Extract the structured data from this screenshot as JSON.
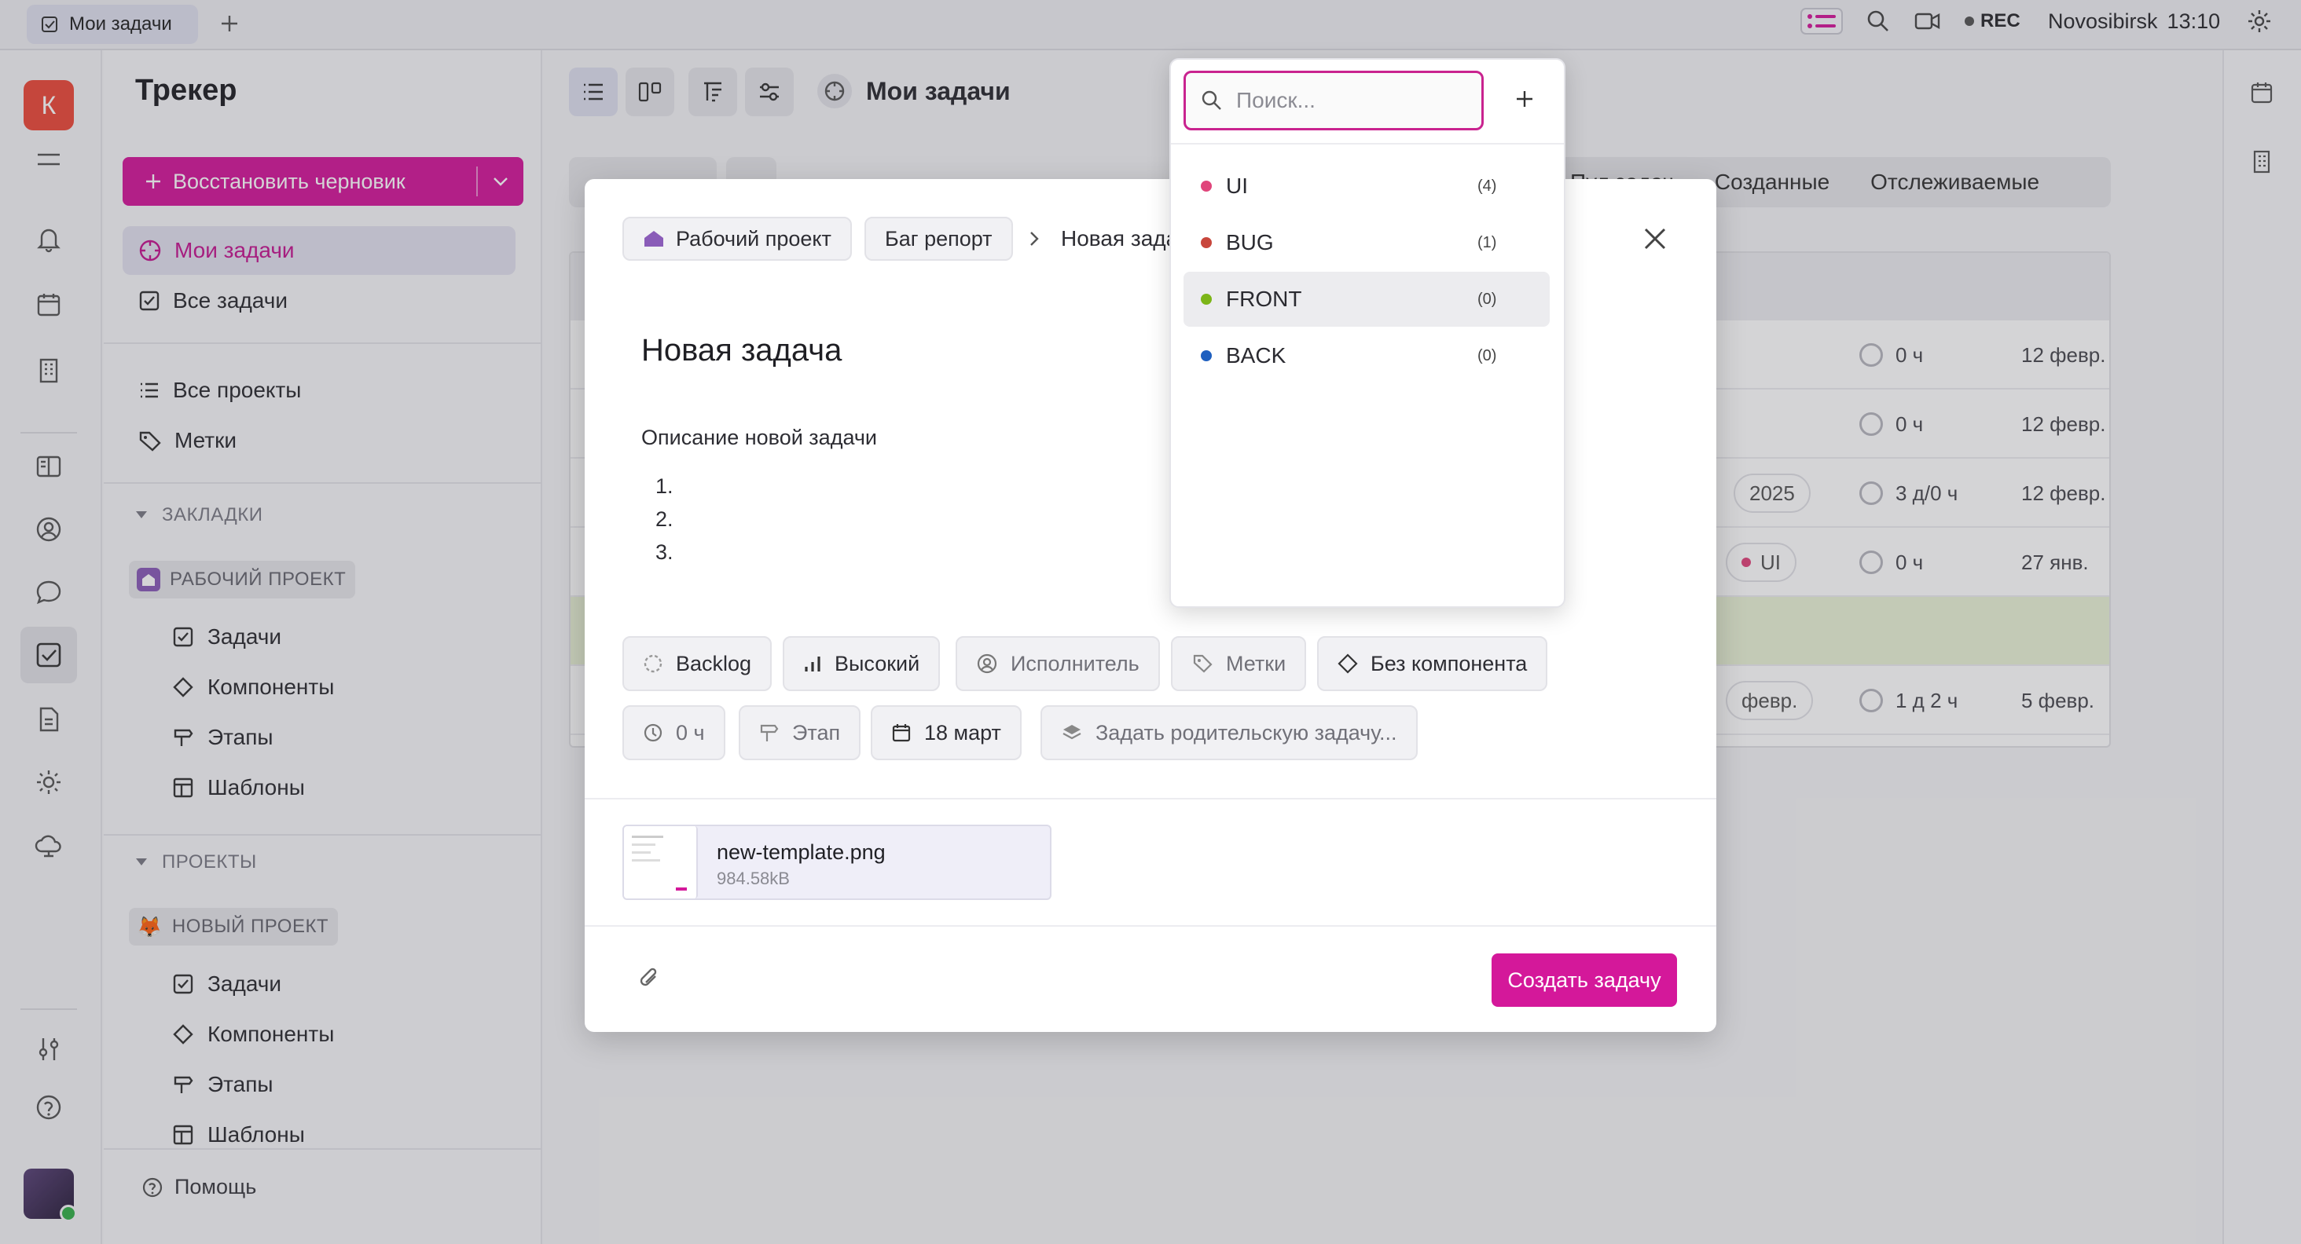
{
  "tab": {
    "label": "Мои задачи"
  },
  "topbar": {
    "rec": "REC",
    "location": "Novosibirsk",
    "time": "13:10"
  },
  "user": {
    "initial": "К"
  },
  "sidebar": {
    "title": "Трекер",
    "restore_label": "Восстановить черновик",
    "nav": [
      {
        "label": "Мои задачи"
      },
      {
        "label": "Все задачи"
      },
      {
        "label": "Все проекты"
      },
      {
        "label": "Метки"
      }
    ],
    "bookmarks_head": "ЗАКЛАДКИ",
    "work_project": "РАБОЧИЙ ПРОЕКТ",
    "work_items": [
      "Задачи",
      "Компоненты",
      "Этапы",
      "Шаблоны"
    ],
    "projects_head": "ПРОЕКТЫ",
    "new_project": "НОВЫЙ ПРОЕКТ",
    "new_items": [
      "Задачи",
      "Компоненты",
      "Этапы",
      "Шаблоны"
    ],
    "help": "Помощь"
  },
  "main": {
    "title": "Мои задачи",
    "filter_tabs": [
      "Пул задач",
      "Созданные",
      "Отслеживаемые"
    ],
    "rows": [
      {
        "time": "0 ч",
        "date": "12 февр."
      },
      {
        "time": "0 ч",
        "date": "12 февр."
      },
      {
        "pill": "2025",
        "time": "3 д/0 ч",
        "date": "12 февр."
      },
      {
        "pill": "UI",
        "time": "0 ч",
        "date": "27 янв."
      },
      {
        "pill": "февр.",
        "time": "1 д 2 ч",
        "date": "5 февр."
      }
    ]
  },
  "modal": {
    "crumb_project": "Рабочий проект",
    "crumb_type": "Баг репорт",
    "crumb_current": "Новая зада",
    "title": "Новая задача",
    "description": "Описание новой задачи",
    "list": [
      "1.",
      "2.",
      "3."
    ],
    "props": {
      "status": "Backlog",
      "priority": "Высокий",
      "assignee": "Исполнитель",
      "labels": "Метки",
      "component": "Без компонента",
      "estimate": "0 ч",
      "stage": "Этап",
      "date": "18 март",
      "parent": "Задать родительскую задачу..."
    },
    "attachment": {
      "name": "new-template.png",
      "size": "984.58kB"
    },
    "create_label": "Создать задачу"
  },
  "dropdown": {
    "search_placeholder": "Поиск...",
    "items": [
      {
        "label": "UI",
        "count": "(4)",
        "color": "#e0457b"
      },
      {
        "label": "BUG",
        "count": "(1)",
        "color": "#c8463c"
      },
      {
        "label": "FRONT",
        "count": "(0)",
        "color": "#7cb518"
      },
      {
        "label": "BACK",
        "count": "(0)",
        "color": "#1e5fbf"
      }
    ]
  },
  "colors": {
    "accent": "#d4189a",
    "active_nav_bg": "#e2e1ef"
  },
  "icons": [
    "checkbox-icon",
    "plus-icon",
    "search-icon",
    "video-icon",
    "gear-icon",
    "bell-icon",
    "calendar-icon",
    "building-icon",
    "book-icon",
    "user-circle-icon",
    "chat-icon",
    "document-icon",
    "sun-icon",
    "cloud-icon",
    "sliders-icon",
    "help-icon",
    "list-icon",
    "kanban-icon",
    "sort-icon",
    "filter-icon",
    "crosshair-icon",
    "chevron-right-icon",
    "close-icon",
    "clock-icon",
    "paperclip-icon",
    "tag-icon",
    "diamond-icon",
    "signpost-icon",
    "layers-icon",
    "bar-chart-icon"
  ]
}
